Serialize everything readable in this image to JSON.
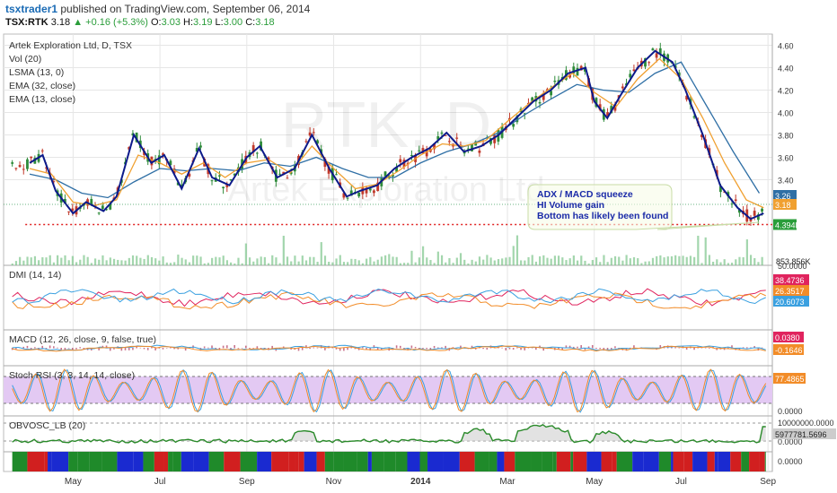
{
  "header": {
    "username": "tsxtrader1",
    "published": "published on TradingView.com, September 06, 2014",
    "symbol": "TSX:RTK",
    "last": "3.18",
    "change": "▲ +0.16 (+5.3%)",
    "open_label": "O:",
    "open": "3.03",
    "high_label": "H:",
    "high": "3.19",
    "low_label": "L:",
    "low": "3.00",
    "close_label": "C:",
    "close": "3.18"
  },
  "watermark": {
    "ticker": "RTK, D",
    "company": "Artek Exploration Ltd"
  },
  "chart_data": [
    {
      "type": "line",
      "panel": "price",
      "legend": [
        "Artek Exploration Ltd, D, TSX",
        "Vol (20)",
        "LSMA (13, 0)",
        "EMA (32, close)",
        "EMA (13, close)"
      ],
      "ylim": [
        2.7,
        4.7
      ],
      "y_ticks": [
        "4.60",
        "4.40",
        "4.20",
        "4.00",
        "3.80",
        "3.60",
        "3.40"
      ],
      "x_labels": [
        "May",
        "Jul",
        "Sep",
        "Nov",
        "2014",
        "Mar",
        "May",
        "Jul",
        "Sep"
      ],
      "x_months": [
        1,
        3,
        5,
        7,
        9,
        11,
        13,
        15,
        17
      ],
      "x_range": [
        -0.6,
        17.1
      ],
      "series": [
        {
          "name": "LSMA (13, 0)",
          "color": "#0d1a8a",
          "x": [
            0,
            0.3,
            0.6,
            1.0,
            1.3,
            1.7,
            2.0,
            2.4,
            2.8,
            3.1,
            3.5,
            3.9,
            4.2,
            4.6,
            5.0,
            5.3,
            5.7,
            6.1,
            6.5,
            6.9,
            7.3,
            7.6,
            8.0,
            8.4,
            8.8,
            9.2,
            9.6,
            10.0,
            10.4,
            10.8,
            11.2,
            11.6,
            12.0,
            12.4,
            12.8,
            13.0,
            13.3,
            13.6,
            14.0,
            14.4,
            14.8,
            15.1,
            15.5,
            15.9,
            16.3,
            16.6,
            16.9
          ],
          "y": [
            3.55,
            3.62,
            3.3,
            3.1,
            3.2,
            3.12,
            3.25,
            3.8,
            3.55,
            3.62,
            3.32,
            3.68,
            3.42,
            3.35,
            3.6,
            3.7,
            3.42,
            3.5,
            3.8,
            3.5,
            3.25,
            3.3,
            3.35,
            3.5,
            3.6,
            3.68,
            3.82,
            3.65,
            3.7,
            3.8,
            3.95,
            4.1,
            4.2,
            4.35,
            4.4,
            4.1,
            3.95,
            4.15,
            4.4,
            4.55,
            4.45,
            4.2,
            3.8,
            3.35,
            3.15,
            3.05,
            3.1
          ]
        },
        {
          "name": "EMA (13, close)",
          "color": "#f0a030",
          "x": [
            0,
            0.5,
            1.0,
            1.5,
            2.0,
            2.5,
            3.0,
            3.5,
            4.0,
            4.5,
            5.0,
            5.5,
            6.0,
            6.5,
            7.0,
            7.5,
            8.0,
            8.5,
            9.0,
            9.5,
            10.0,
            10.5,
            11.0,
            11.5,
            12.0,
            12.5,
            13.0,
            13.5,
            14.0,
            14.5,
            15.0,
            15.5,
            16.0,
            16.5,
            16.9
          ],
          "y": [
            3.5,
            3.45,
            3.2,
            3.17,
            3.22,
            3.62,
            3.55,
            3.45,
            3.55,
            3.42,
            3.55,
            3.58,
            3.46,
            3.7,
            3.5,
            3.32,
            3.36,
            3.48,
            3.62,
            3.72,
            3.7,
            3.75,
            3.92,
            4.08,
            4.22,
            4.35,
            4.18,
            4.05,
            4.3,
            4.48,
            4.3,
            3.95,
            3.55,
            3.22,
            3.15
          ]
        },
        {
          "name": "EMA (32, close)",
          "color": "#2f6fa5",
          "x": [
            0,
            0.6,
            1.2,
            1.8,
            2.4,
            3.0,
            3.6,
            4.2,
            4.8,
            5.4,
            6.0,
            6.6,
            7.2,
            7.8,
            8.4,
            9.0,
            9.6,
            10.2,
            10.8,
            11.4,
            12.0,
            12.6,
            13.2,
            13.8,
            14.4,
            15.0,
            15.6,
            16.2,
            16.8
          ],
          "y": [
            3.45,
            3.4,
            3.28,
            3.24,
            3.38,
            3.5,
            3.48,
            3.5,
            3.48,
            3.55,
            3.52,
            3.6,
            3.5,
            3.42,
            3.42,
            3.55,
            3.65,
            3.72,
            3.82,
            3.98,
            4.12,
            4.25,
            4.2,
            4.18,
            4.35,
            4.45,
            4.05,
            3.65,
            3.28
          ]
        }
      ],
      "support_level": 3.0,
      "callout": [
        "ADX / MACD squeeze",
        "HI Volume gain",
        "Bottom has likely been found"
      ],
      "price_badges": [
        {
          "label": "3.26",
          "y": 3.26,
          "color": "#2f6fa5"
        },
        {
          "label": "3.18",
          "y": 3.18,
          "color": "#f0a030"
        },
        {
          "label": "4.394M",
          "y": 3.0,
          "color": "#2a9d3a"
        }
      ],
      "volume_label": "853.856K"
    },
    {
      "type": "line",
      "panel": "dmi",
      "title": "DMI (14, 14)",
      "ylim": [
        0,
        55
      ],
      "y_ticks": [
        "50.0000"
      ],
      "badges": [
        {
          "label": "38.4736",
          "color": "#e0245e"
        },
        {
          "label": "26.3517",
          "color": "#f28c28"
        },
        {
          "label": "20.6073",
          "color": "#3aa0e0"
        }
      ]
    },
    {
      "type": "line",
      "panel": "macd",
      "title": "MACD (12, 26, close, 9, false, true)",
      "badges": [
        {
          "label": "0.0380",
          "color": "#e0245e"
        },
        {
          "label": "-0.1646",
          "color": "#f28c28"
        }
      ]
    },
    {
      "type": "line",
      "panel": "stochrsi",
      "title": "Stoch RSI (3, 3, 14, 14, close)",
      "ylim": [
        0,
        100
      ],
      "y_ticks": [
        "0.0000"
      ],
      "badges": [
        {
          "label": "77.4865",
          "color": "#f28c28"
        }
      ]
    },
    {
      "type": "area",
      "panel": "obvosc",
      "title": "OBVOSC_LB (20)",
      "y_ticks": [
        "10000000.0000",
        "0.0000"
      ],
      "badges": [
        {
          "label": "5977781.5696",
          "color": "#cccccc"
        }
      ]
    },
    {
      "type": "heatmap",
      "panel": "colorbars",
      "y_ticks": [
        "0.0000"
      ]
    }
  ],
  "colors": {
    "up_candle": "#2e8b3a",
    "down_candle": "#c0392b",
    "grid": "#e6e6e6",
    "stoch_band": "#e3c9f3",
    "callout_text": "#1a2aa8",
    "support": "#e02020"
  }
}
